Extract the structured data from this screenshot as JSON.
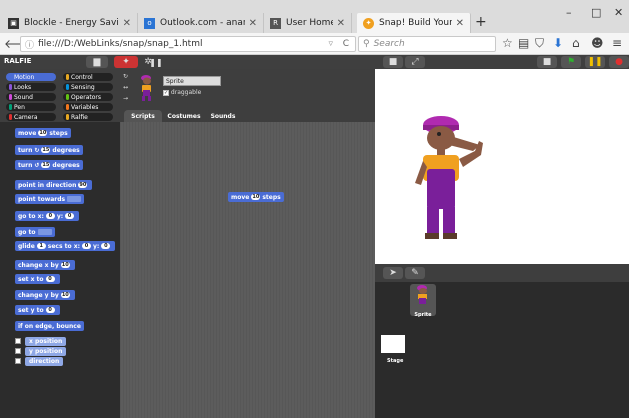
{
  "browser": {
    "tabs": [
      {
        "label": "Blockle - Energy Saving Se...",
        "active": false,
        "favicon": "blockle-icon",
        "color": "#333333"
      },
      {
        "label": "Outlook.com - anandama...",
        "active": false,
        "favicon": "outlook-icon",
        "color": "#2a74d4"
      },
      {
        "label": "User Home",
        "active": false,
        "favicon": "pdf-icon",
        "color": "#c94040"
      },
      {
        "label": "Snap! Build Your Own Blo...",
        "active": true,
        "favicon": "snap-icon",
        "color": "#f0a020"
      }
    ],
    "new_tab": "+",
    "window_controls": {
      "minimize": "–",
      "maximize": "□",
      "close": "✕"
    },
    "url": "file:///D:/WebLinks/snap/snap_1.html",
    "search_placeholder": "Search",
    "reload": "C",
    "dropdown": "▿"
  },
  "snap": {
    "app_label": "RALFIE",
    "categories": [
      {
        "label": "Motion",
        "color": "#4a6cd4"
      },
      {
        "label": "Control",
        "color": "#e6a822"
      },
      {
        "label": "Looks",
        "color": "#8a55d7"
      },
      {
        "label": "Sensing",
        "color": "#0494dc"
      },
      {
        "label": "Sound",
        "color": "#cf4ad9"
      },
      {
        "label": "Operators",
        "color": "#62c213"
      },
      {
        "label": "Pen",
        "color": "#00a178"
      },
      {
        "label": "Variables",
        "color": "#f3761d"
      },
      {
        "label": "Camera",
        "color": "#e03030"
      },
      {
        "label": "Ralfie",
        "color": "#e6a822"
      }
    ],
    "blocks": {
      "move": {
        "pre": "move",
        "val": "10",
        "post": "steps"
      },
      "turn_cw": {
        "pre": "turn",
        "glyph": "↻",
        "val": "15",
        "post": "degrees"
      },
      "turn_ccw": {
        "pre": "turn",
        "glyph": "↺",
        "val": "15",
        "post": "degrees"
      },
      "point_dir": {
        "pre": "point in direction",
        "val": "90"
      },
      "point_towards": {
        "pre": "point towards"
      },
      "goto_xy": {
        "pre": "go to x:",
        "x": "0",
        "mid": "y:",
        "y": "0"
      },
      "goto": {
        "pre": "go to"
      },
      "glide": {
        "pre": "glide",
        "secs": "1",
        "mid1": "secs to x:",
        "x": "0",
        "mid2": "y:",
        "y": "0"
      },
      "change_x": {
        "pre": "change x by",
        "val": "10"
      },
      "set_x": {
        "pre": "set x to",
        "val": "0"
      },
      "change_y": {
        "pre": "change y by",
        "val": "10"
      },
      "set_y": {
        "pre": "set y to",
        "val": "0"
      },
      "bounce": {
        "label": "if on edge, bounce"
      },
      "x_position": {
        "label": "x position"
      },
      "y_position": {
        "label": "y position"
      },
      "direction": {
        "label": "direction"
      }
    },
    "sprite": {
      "name": "Sprite",
      "draggable_label": "draggable"
    },
    "tabs": [
      "Scripts",
      "Costumes",
      "Sounds"
    ],
    "script_block": {
      "pre": "move",
      "val": "10",
      "post": "steps"
    },
    "corral": {
      "sprite_label": "Sprite",
      "stage_label": "Stage"
    }
  }
}
